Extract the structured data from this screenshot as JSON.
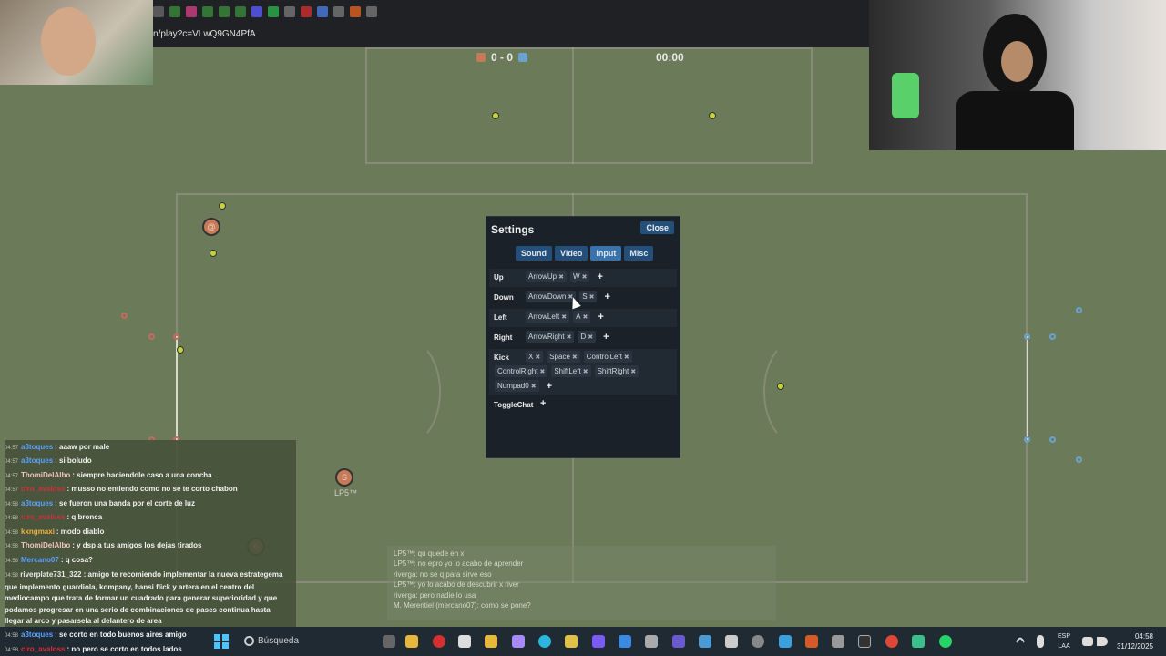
{
  "browser": {
    "url": "n/play?c=VLwQ9GN4PfA"
  },
  "scoreboard": {
    "score": "0 - 0",
    "timer": "00:00",
    "red_color": "#c77a5a",
    "blue_color": "#6aa3d0"
  },
  "players": [
    {
      "avatar": "@"
    },
    {
      "avatar": "S",
      "name": "LP5™"
    },
    {
      "avatar": "6"
    }
  ],
  "settings": {
    "title": "Settings",
    "close_label": "Close",
    "tabs": [
      "Sound",
      "Video",
      "Input",
      "Misc"
    ],
    "active_tab": "Input",
    "bindings": [
      {
        "label": "Up",
        "keys": [
          "ArrowUp",
          "W"
        ]
      },
      {
        "label": "Down",
        "keys": [
          "ArrowDown",
          "S"
        ]
      },
      {
        "label": "Left",
        "keys": [
          "ArrowLeft",
          "A"
        ]
      },
      {
        "label": "Right",
        "keys": [
          "ArrowRight",
          "D"
        ]
      },
      {
        "label": "Kick",
        "keys": [
          "X",
          "Space",
          "ControlLeft",
          "ControlRight",
          "ShiftLeft",
          "ShiftRight",
          "Numpad0"
        ]
      },
      {
        "label": "ToggleChat",
        "keys": []
      }
    ],
    "remove_symbol": "✖",
    "add_symbol": "+"
  },
  "stream_chat": [
    {
      "time": "04:57",
      "user": "a3toques",
      "user_color": "#5aa0ff",
      "message": ": aaaw por male"
    },
    {
      "time": "04:57",
      "user": "a3toques",
      "user_color": "#5aa0ff",
      "message": ": si boludo"
    },
    {
      "time": "04:57",
      "user": "ThomiDelAlbo",
      "user_color": "#f3c2c2",
      "message": ": siempre haciendole caso a una concha"
    },
    {
      "time": "04:57",
      "user": "ciro_avaloss",
      "user_color": "#d0303a",
      "message": ": musso no entiendo como no se te corto chabon"
    },
    {
      "time": "04:58",
      "user": "a3toques",
      "user_color": "#5aa0ff",
      "message": ": se fueron una banda por el corte de luz"
    },
    {
      "time": "04:58",
      "user": "ciro_avaloss",
      "user_color": "#d0303a",
      "message": ": q bronca"
    },
    {
      "time": "04:58",
      "user": "kxngmaxi",
      "user_color": "#f0b040",
      "message": ": modo diablo"
    },
    {
      "time": "04:58",
      "user": "ThomiDelAlbo",
      "user_color": "#f3c2c2",
      "message": ": y dsp a tus amigos los dejas tirados"
    },
    {
      "time": "04:58",
      "user": "Mercano07",
      "user_color": "#5aa0ff",
      "message": ": q cosa?"
    }
  ],
  "stream_chat_long": {
    "time": "04:58",
    "user": "riverplate731_322",
    "message": ": amigo te recomiendo implementar la nueva estrategema que implemento guardiola, kompany, hansi flick y artera en el centro del mediocampo que trata de formar un cuadrado para generar superioridad y que podamos progresar en una serio de combinaciones de pases continua hasta llegar al arco y pasarsela al delantero de area"
  },
  "stream_chat_tail": [
    {
      "time": "04:58",
      "user": "a3toques",
      "user_color": "#5aa0ff",
      "message": ": se corto en todo buenos aires amigo"
    },
    {
      "time": "04:58",
      "user": "ciro_avaloss",
      "user_color": "#d0303a",
      "message": ": no pero se corto en todos lados"
    }
  ],
  "game_chat": [
    "LP5™: qu quede en x",
    "LP5™: no epro yo lo acabo de aprender",
    "riverga: no se q para sirve eso",
    "LP5™: yo lo acabo de descubrir x river",
    "riverga: pero nadie lo usa",
    "M. Merentiel (mercano07): como se pone?"
  ],
  "taskbar": {
    "search_placeholder": "Búsqueda",
    "lang_top": "ESP",
    "lang_bottom": "LAA",
    "time": "04:58",
    "date": "31/12/2025"
  }
}
